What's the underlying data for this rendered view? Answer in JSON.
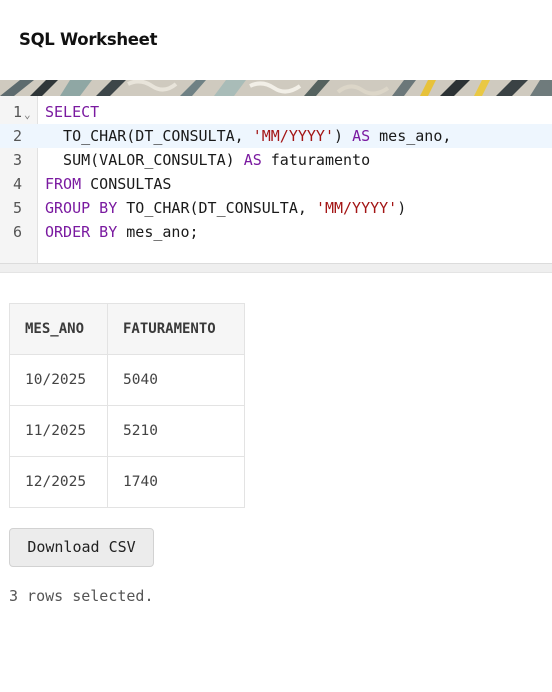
{
  "header": {
    "title": "SQL Worksheet"
  },
  "editor": {
    "active_line": 2,
    "lines": [
      {
        "num": "1",
        "code": "SELECT"
      },
      {
        "num": "2",
        "code": "  TO_CHAR(DT_CONSULTA, 'MM/YYYY') AS mes_ano,"
      },
      {
        "num": "3",
        "code": "  SUM(VALOR_CONSULTA) AS faturamento"
      },
      {
        "num": "4",
        "code": "FROM CONSULTAS"
      },
      {
        "num": "5",
        "code": "GROUP BY TO_CHAR(DT_CONSULTA, 'MM/YYYY')"
      },
      {
        "num": "6",
        "code": "ORDER BY mes_ano;"
      }
    ],
    "fold_glyph": "⌄"
  },
  "results": {
    "columns": [
      "MES_ANO",
      "FATURAMENTO"
    ],
    "rows": [
      [
        "10/2025",
        "5040"
      ],
      [
        "11/2025",
        "5210"
      ],
      [
        "12/2025",
        "1740"
      ]
    ]
  },
  "actions": {
    "download_label": "Download CSV"
  },
  "status": {
    "text": "3 rows selected."
  },
  "colors": {
    "keyword": "#7a1aa0",
    "string": "#a31515",
    "active_line": "#eef6fe"
  }
}
